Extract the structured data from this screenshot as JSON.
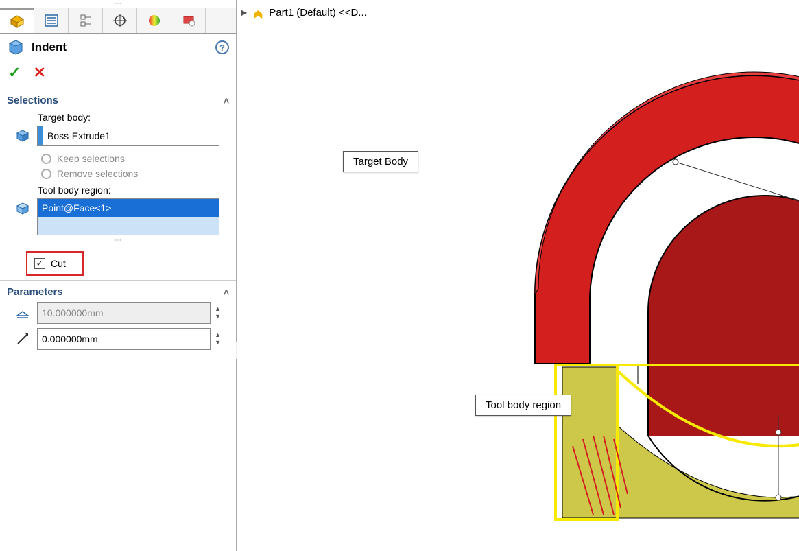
{
  "breadcrumb": {
    "part": "Part1 (Default) <<D..."
  },
  "panel": {
    "feature_name": "Indent",
    "sections": {
      "selections": {
        "title": "Selections",
        "target_label": "Target body:",
        "target_value": "Boss-Extrude1",
        "keep_label": "Keep selections",
        "remove_label": "Remove selections",
        "tool_label": "Tool body region:",
        "tool_value": "Point@Face<1>",
        "cut_label": "Cut",
        "cut_checked": true
      },
      "parameters": {
        "title": "Parameters",
        "offset_value": "10.000000mm",
        "clearance_value": "0.000000mm"
      }
    }
  },
  "callouts": {
    "target": "Target Body",
    "tool": "Tool body region"
  },
  "colors": {
    "red_face": "#d3201f",
    "red_dark": "#a81818",
    "yellow": "#c9c33a",
    "yellow_line": "#f7ea00",
    "edge": "#000"
  }
}
